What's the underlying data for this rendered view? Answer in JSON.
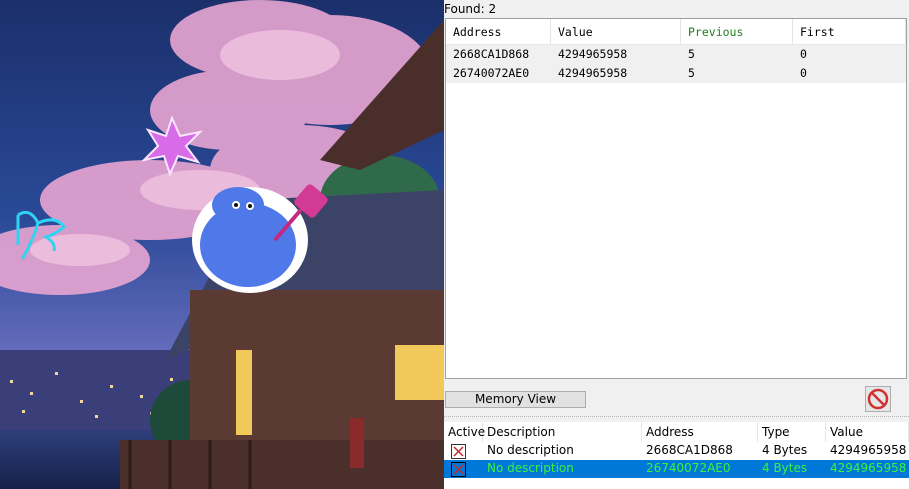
{
  "found_label": "Found:",
  "found_count": "2",
  "results": {
    "columns": [
      "Address",
      "Value",
      "Previous",
      "First"
    ],
    "rows": [
      {
        "address": "2668CA1D868",
        "value": "4294965958",
        "previous": "5",
        "first": "0"
      },
      {
        "address": "26740072AE0",
        "value": "4294965958",
        "previous": "5",
        "first": "0"
      }
    ]
  },
  "memory_view_label": "Memory View",
  "address_list": {
    "columns": [
      "Active",
      "Description",
      "Address",
      "Type",
      "Value"
    ],
    "rows": [
      {
        "description": "No description",
        "address": "2668CA1D868",
        "type": "4 Bytes",
        "value": "4294965958",
        "selected": false
      },
      {
        "description": "No description",
        "address": "26740072AE0",
        "type": "4 Bytes",
        "value": "4294965958",
        "selected": true
      }
    ]
  },
  "colors": {
    "previous_header": "#1c7f1c",
    "selection": "#0078d7",
    "selected_text": "#3cf23c",
    "stop_icon": "#d32f2f"
  },
  "wallpaper": {
    "icons": [
      "purple-sparkle-icon",
      "butterfly-icon",
      "blue-cat-with-flyswatter-sticker"
    ]
  }
}
